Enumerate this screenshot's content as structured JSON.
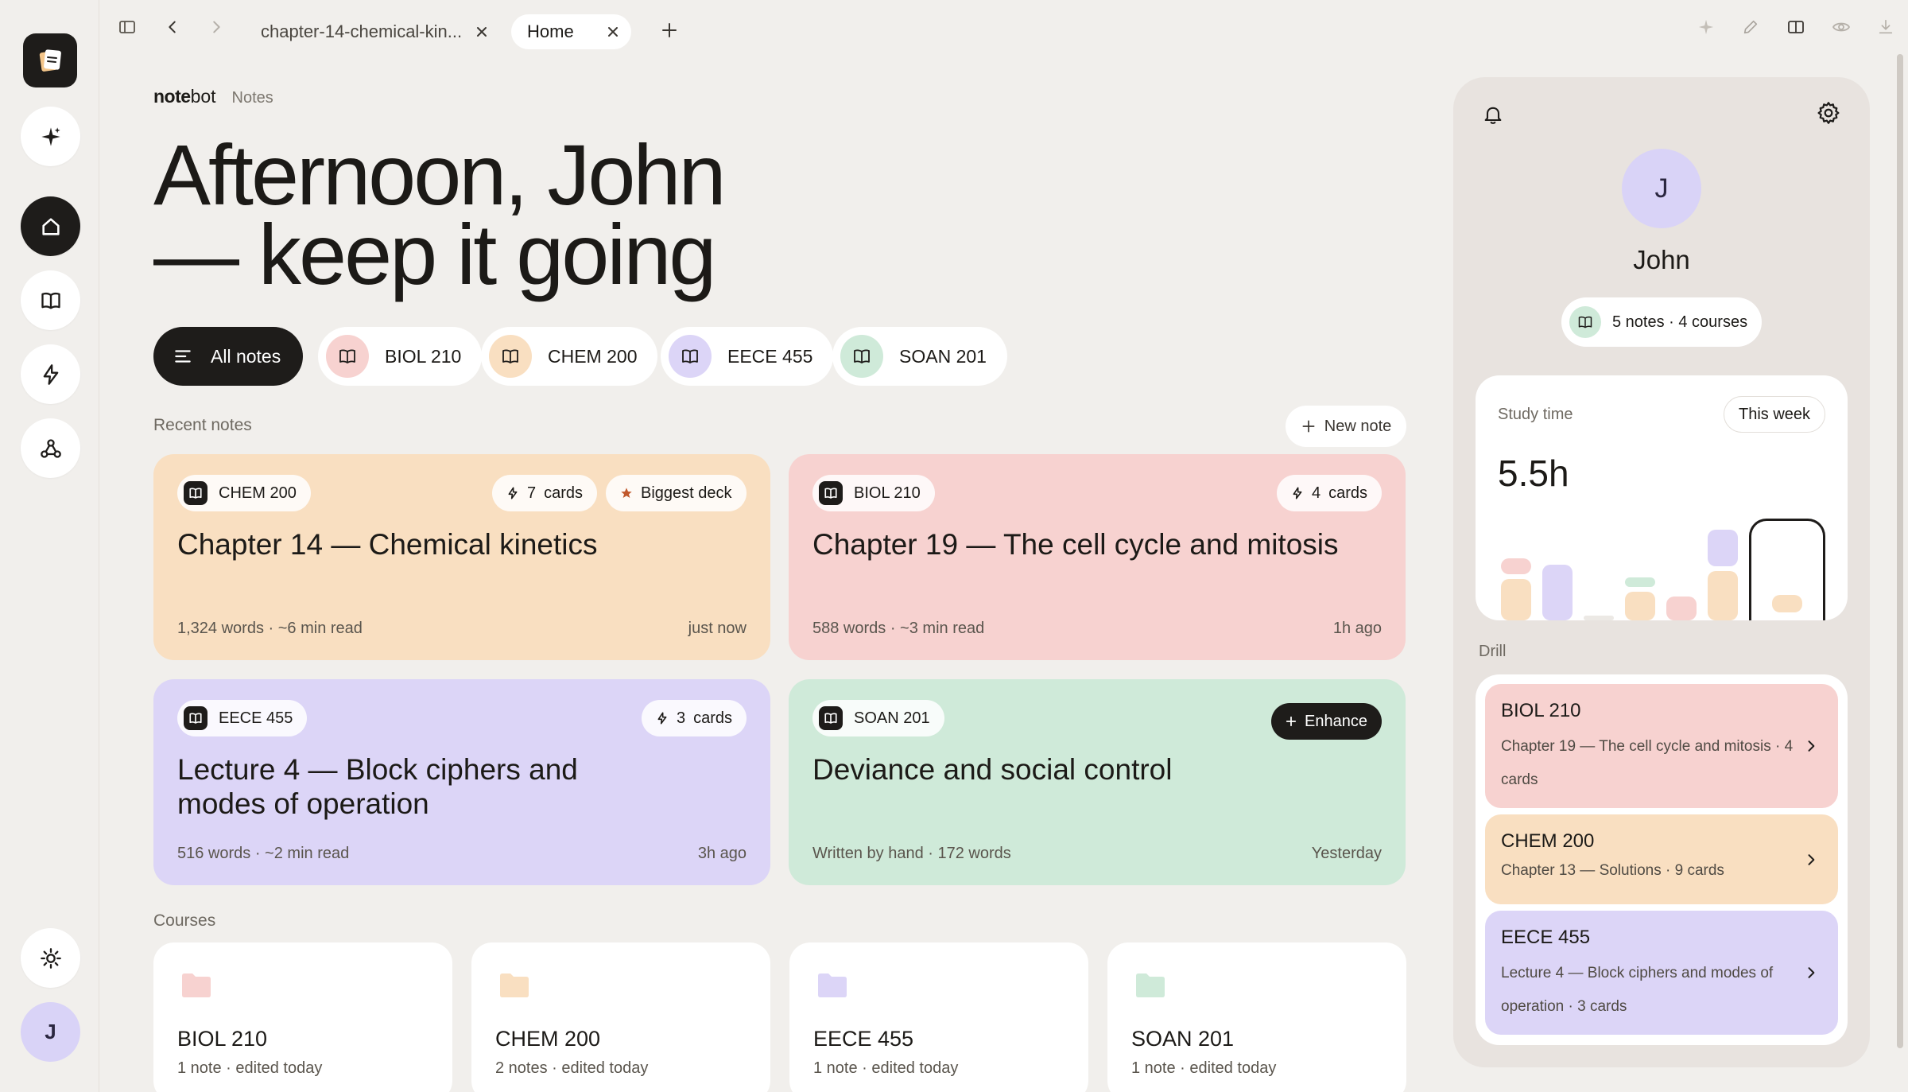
{
  "topbar": {
    "tabs": [
      {
        "label": "chapter-14-chemical-kin...",
        "active": false
      },
      {
        "label": "Home",
        "active": true
      }
    ]
  },
  "brand": {
    "name_bold": "note",
    "name_rest": "bot",
    "section": "Notes"
  },
  "greeting": {
    "line1": "Afternoon, John",
    "line2": "— keep it going"
  },
  "filters": [
    {
      "label": "All notes",
      "active": true,
      "icon": "list-icon"
    },
    {
      "label": "BIOL 210",
      "color": "#f7d2d0",
      "icon": "book-icon"
    },
    {
      "label": "CHEM 200",
      "color": "#f9dfc1",
      "icon": "book-icon"
    },
    {
      "label": "EECE 455",
      "color": "#dcd5f7",
      "icon": "book-icon"
    },
    {
      "label": "SOAN 201",
      "color": "#cfead9",
      "icon": "book-icon"
    }
  ],
  "recent": {
    "label": "Recent notes",
    "new_note": "New note",
    "cards": [
      {
        "course": "CHEM 200",
        "title": "Chapter 14 — Chemical kinetics",
        "cards_count": "7",
        "cards_unit": "cards",
        "extra_badge": "Biggest deck",
        "meta": "1,324 words · ~6 min read",
        "time": "just now",
        "color": "#f9dfc1"
      },
      {
        "course": "BIOL 210",
        "title": "Chapter 19 — The cell cycle and mitosis",
        "cards_count": "4",
        "cards_unit": "cards",
        "meta": "588 words · ~3 min read",
        "time": "1h ago",
        "color": "#f7d2d0"
      },
      {
        "course": "EECE 455",
        "title": "Lecture 4 — Block ciphers and modes of operation",
        "cards_count": "3",
        "cards_unit": "cards",
        "meta": "516 words · ~2 min read",
        "time": "3h ago",
        "color": "#dcd5f7"
      },
      {
        "course": "SOAN 201",
        "title": "Deviance and social control",
        "action": "Enhance",
        "meta": "Written by hand · 172 words",
        "time": "Yesterday",
        "color": "#cfead9"
      }
    ]
  },
  "courses": {
    "label": "Courses",
    "items": [
      {
        "name": "BIOL 210",
        "meta": "1 note · edited today",
        "color": "#f7d2d0"
      },
      {
        "name": "CHEM 200",
        "meta": "2 notes · edited today",
        "color": "#f9dfc1"
      },
      {
        "name": "EECE 455",
        "meta": "1 note · edited today",
        "color": "#dcd5f7"
      },
      {
        "name": "SOAN 201",
        "meta": "1 note · edited today",
        "color": "#cfead9"
      }
    ]
  },
  "profile": {
    "initial": "J",
    "name": "John",
    "stats": "5 notes · 4 courses"
  },
  "study": {
    "label": "Study time",
    "range": "This week",
    "value": "5.5h"
  },
  "drill": {
    "label": "Drill",
    "items": [
      {
        "course": "BIOL 210",
        "desc": "Chapter 19 — The cell cycle and mitosis · 4 cards",
        "color": "#f7d2d0"
      },
      {
        "course": "CHEM 200",
        "desc": "Chapter 13 — Solutions · 9 cards",
        "color": "#f9dfc1"
      },
      {
        "course": "EECE 455",
        "desc": "Lecture 4 — Block ciphers and modes of operation · 3 cards",
        "color": "#dcd5f7"
      }
    ]
  },
  "rail": {
    "avatar_initial": "J"
  }
}
